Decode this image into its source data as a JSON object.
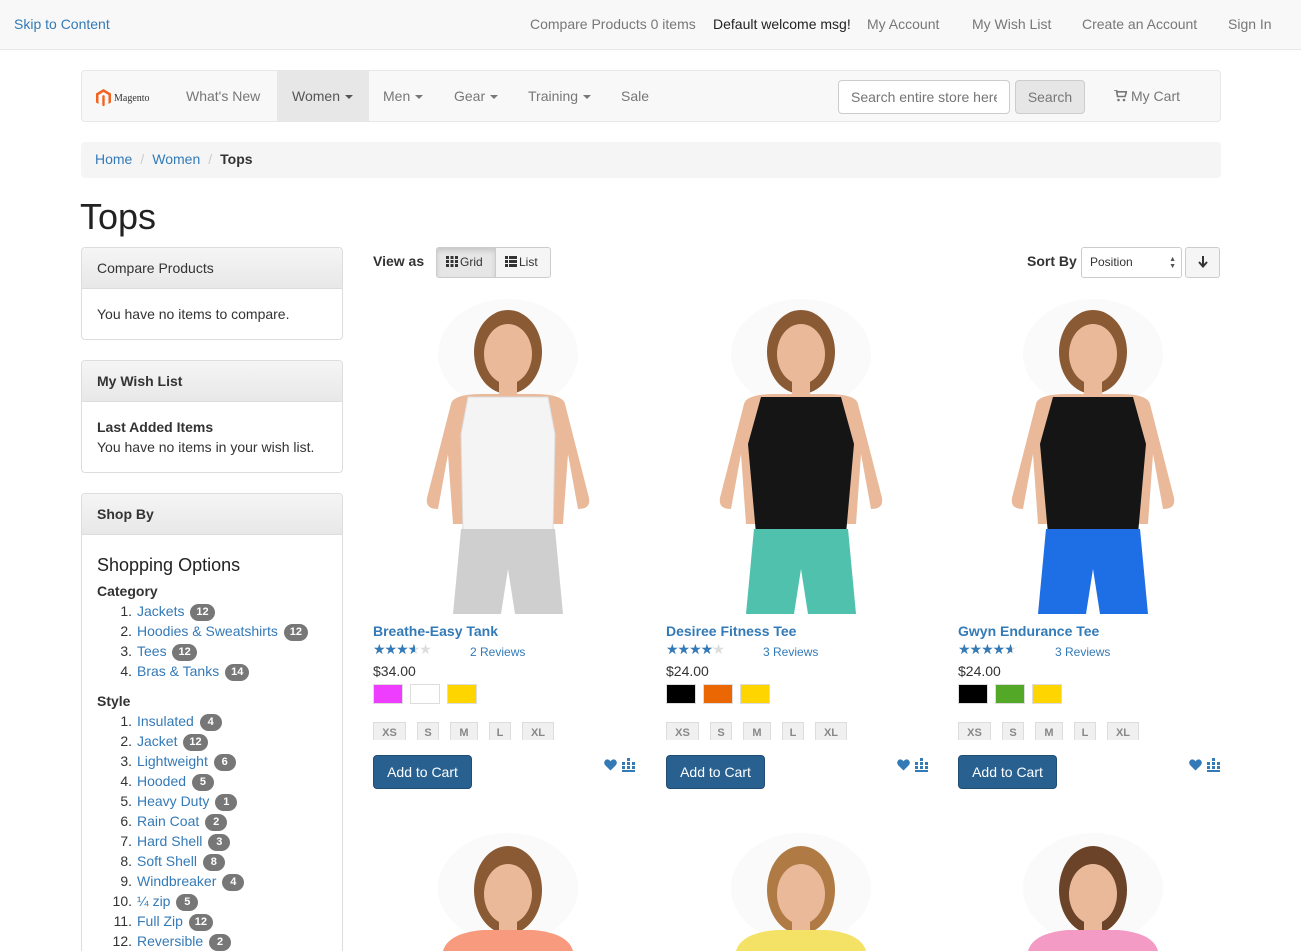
{
  "header": {
    "skip_link": "Skip to Content",
    "compare_products": "Compare Products 0 items",
    "welcome": "Default welcome msg!",
    "my_account": "My Account",
    "my_wish_list": "My Wish List",
    "create_account": "Create an Account",
    "sign_in": "Sign In"
  },
  "nav": {
    "logo_text": "Magento",
    "items": [
      "What's New",
      "Women",
      "Men",
      "Gear",
      "Training",
      "Sale"
    ],
    "active_item": "Women",
    "search_placeholder": "Search entire store here...",
    "search_button": "Search",
    "cart_label": "My Cart"
  },
  "breadcrumb": [
    "Home",
    "Women",
    "Tops"
  ],
  "page_title": "Tops",
  "sidebar": {
    "compare": {
      "title": "Compare Products",
      "empty_text": "You have no items to compare."
    },
    "wishlist": {
      "title": "My Wish List",
      "last_added": "Last Added Items",
      "empty_text": "You have no items in your wish list."
    },
    "shop_by": {
      "title": "Shop By",
      "subtitle": "Shopping Options",
      "category_label": "Category",
      "categories": [
        {
          "num": "1.",
          "label": "Jackets",
          "count": "12"
        },
        {
          "num": "2.",
          "label": "Hoodies & Sweatshirts",
          "count": "12"
        },
        {
          "num": "3.",
          "label": "Tees",
          "count": "12"
        },
        {
          "num": "4.",
          "label": "Bras & Tanks",
          "count": "14"
        }
      ],
      "style_label": "Style",
      "styles": [
        {
          "num": "1.",
          "label": "Insulated",
          "count": "4"
        },
        {
          "num": "2.",
          "label": "Jacket",
          "count": "12"
        },
        {
          "num": "3.",
          "label": "Lightweight",
          "count": "6"
        },
        {
          "num": "4.",
          "label": "Hooded",
          "count": "5"
        },
        {
          "num": "5.",
          "label": "Heavy Duty",
          "count": "1"
        },
        {
          "num": "6.",
          "label": "Rain Coat",
          "count": "2"
        },
        {
          "num": "7.",
          "label": "Hard Shell",
          "count": "3"
        },
        {
          "num": "8.",
          "label": "Soft Shell",
          "count": "8"
        },
        {
          "num": "9.",
          "label": "Windbreaker",
          "count": "4"
        },
        {
          "num": "10.",
          "label": "¼ zip",
          "count": "5"
        },
        {
          "num": "11.",
          "label": "Full Zip",
          "count": "12"
        },
        {
          "num": "12.",
          "label": "Reversible",
          "count": "2"
        }
      ]
    }
  },
  "toolbar": {
    "view_as_label": "View as",
    "grid_label": "Grid",
    "list_label": "List",
    "sort_by_label": "Sort By",
    "sort_value": "Position"
  },
  "products": [
    {
      "name": "Breathe-Easy Tank",
      "rating_percent": 70,
      "reviews": "2 Reviews",
      "price": "$34.00",
      "swatches": [
        "#ef3dff",
        "#ffffff",
        "#ffd500"
      ],
      "sizes": [
        "XS",
        "S",
        "M",
        "L",
        "XL"
      ],
      "add_to_cart": "Add to Cart",
      "top_color": "#f4f4f4",
      "bottom_color": "#cfcfcf"
    },
    {
      "name": "Desiree Fitness Tee",
      "rating_percent": 80,
      "reviews": "3 Reviews",
      "price": "$24.00",
      "swatches": [
        "#000000",
        "#eb6703",
        "#ffd500"
      ],
      "sizes": [
        "XS",
        "S",
        "M",
        "L",
        "XL"
      ],
      "add_to_cart": "Add to Cart",
      "top_color": "#151515",
      "bottom_color": "#4fc1ad"
    },
    {
      "name": "Gwyn Endurance Tee",
      "rating_percent": 90,
      "reviews": "3 Reviews",
      "price": "$24.00",
      "swatches": [
        "#000000",
        "#53a828",
        "#ffd500"
      ],
      "sizes": [
        "XS",
        "S",
        "M",
        "L",
        "XL"
      ],
      "add_to_cart": "Add to Cart",
      "top_color": "#151515",
      "bottom_color": "#1e6fe6"
    }
  ],
  "next_row_tops": [
    "#f89a7e",
    "#f4e266",
    "#f39ac5"
  ]
}
